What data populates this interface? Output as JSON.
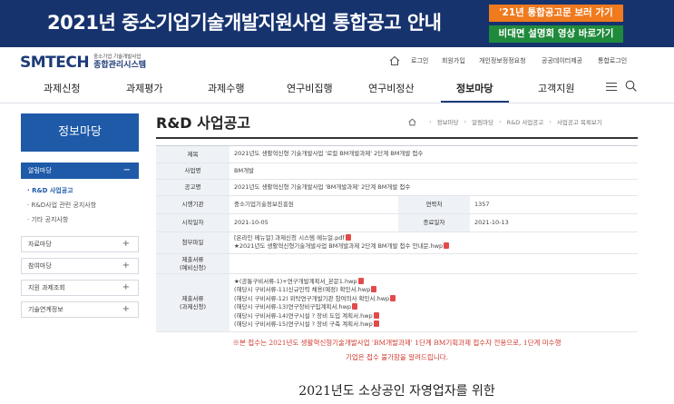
{
  "banner": {
    "title": "2021년 중소기업기술개발지원사업 통합공고 안내",
    "btn_notice": "'21년 통합공고문 보러 가기",
    "btn_video": "비대면 설명회 영상 바로가기",
    "colors": {
      "bg": "#16336e",
      "orange": "#f07a1e",
      "green": "#1f8a3c"
    }
  },
  "header": {
    "logo_main": "SMTECH",
    "logo_sub1": "중소기업 기술개발사업",
    "logo_sub2": "종합관리시스템",
    "util_links": [
      "로그인",
      "회원가입",
      "개인정보정정요청",
      "공공데이터제공",
      "통합로그인"
    ],
    "gnb": [
      "과제신청",
      "과제평가",
      "과제수행",
      "연구비집행",
      "연구비정산",
      "정보마당",
      "고객지원"
    ],
    "gnb_active": "정보마당"
  },
  "lnb": {
    "title": "정보마당",
    "open_group": "알림마당",
    "open_group_toggle": "−",
    "sub_items": [
      "· R&D 사업공고",
      "· R&D사업 관련 공지사항",
      "· 기타 공지사항"
    ],
    "groups": [
      "자료마당",
      "참여마당",
      "지원 과제조회",
      "기술연계정보"
    ],
    "group_toggle": "+",
    "accent": "#1e5aa8"
  },
  "content": {
    "title": "R&D 사업공고",
    "breadcrumb": [
      "정보마당",
      "알림마당",
      "R&D 사업공고",
      "사업공고 목록보기"
    ],
    "rows": {
      "title_label": "제목",
      "title_value": "2021년도 생활혁신형 기술개발사업 '로컬 BM개발과제' 2단계 BM개발 접수",
      "biz_label": "사업명",
      "biz_value": "BM개발",
      "notice_label": "공고명",
      "notice_value": "2021년도 생활혁신형 기술개발사업 'BM개발과제' 2단계 BM개발 접수",
      "agency_label": "시행기관",
      "agency_value": "중소기업기술정보진흥원",
      "views_label": "연락처",
      "views_value": "1357",
      "start_label": "시작일자",
      "start_value": "2021-10-05",
      "end_label": "종료일자",
      "end_value": "2021-10-13",
      "attach_label": "첨부파일",
      "attach_files": [
        "[온라인 메뉴얼] 과제신청 시스템 메뉴얼.pdf",
        "★2021년도 생활혁신형기술개발사업 BM개발과제 2단계 BM개발 접수 안내문.hwp"
      ],
      "req1_label": "제출서류\n(예비신청)",
      "req2_label": "제출서류\n(과제신청)",
      "req2_files": [
        "★(공통구비서류-1)+연구개발계획서_본문1.hwp",
        "(해당시 구비서류-11)신규인력 채용(예정) 확인서.hwp",
        "(해당시 구비서류-12) 위탁연구개발기관 참여의사 확인서.hwp",
        "(해당시 구비서류-13)연구장비구입계획서.hwp",
        "(해당시 구비서류-14)연구시설 ? 장비 도입 계획서.hwp",
        "(해당시 구비서류-15)연구시설 ? 장비 구축 계획서.hwp"
      ]
    },
    "notice_line1": "※본 접수는 2021년도 생활혁신형기술개발사업 'BM개발과제' 1단계 BM기획과제 접수자 전용으로, 1단계 미수행",
    "notice_line2": "기업은 접수 불가함을 알려드립니다.",
    "body_heading": "2021년도 소상공인 자영업자를 위한"
  }
}
